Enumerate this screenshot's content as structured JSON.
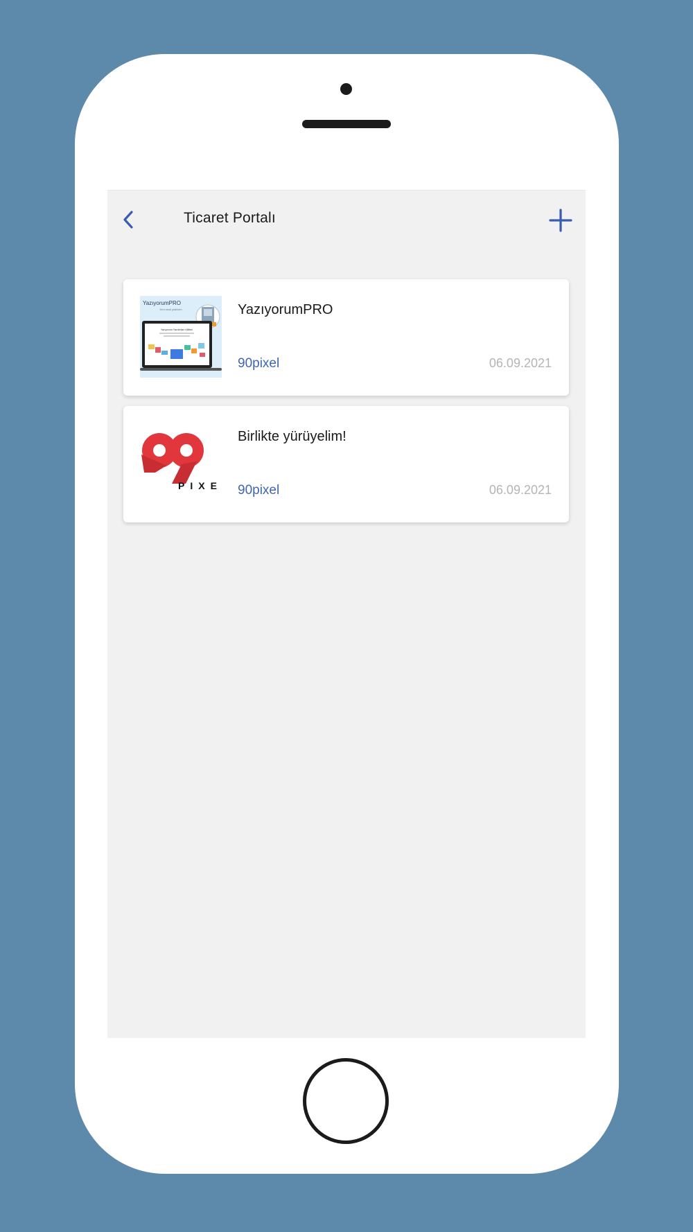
{
  "nav": {
    "title": "Ticaret Portalı",
    "back_icon": "chevron-left-icon",
    "add_icon": "plus-icon"
  },
  "items": [
    {
      "title": "YazıyorumPRO",
      "author": "90pixel",
      "date": "06.09.2021",
      "thumbnail": {
        "brand_text": "YazıyorumPRO",
        "tagline": "Yeni nesil platform",
        "screen_heading": "Yazıyorum Yazılımları Kilitleri"
      }
    },
    {
      "title": "Birlikte yürüyelim!",
      "author": "90pixel",
      "date": "06.09.2021",
      "thumbnail": {
        "logo_number": "90",
        "logo_text": "PIXE"
      }
    }
  ],
  "colors": {
    "background": "#5d8aab",
    "accent": "#3f66b0",
    "logo_red": "#e0363c",
    "screen_bg": "#f1f1f1"
  }
}
